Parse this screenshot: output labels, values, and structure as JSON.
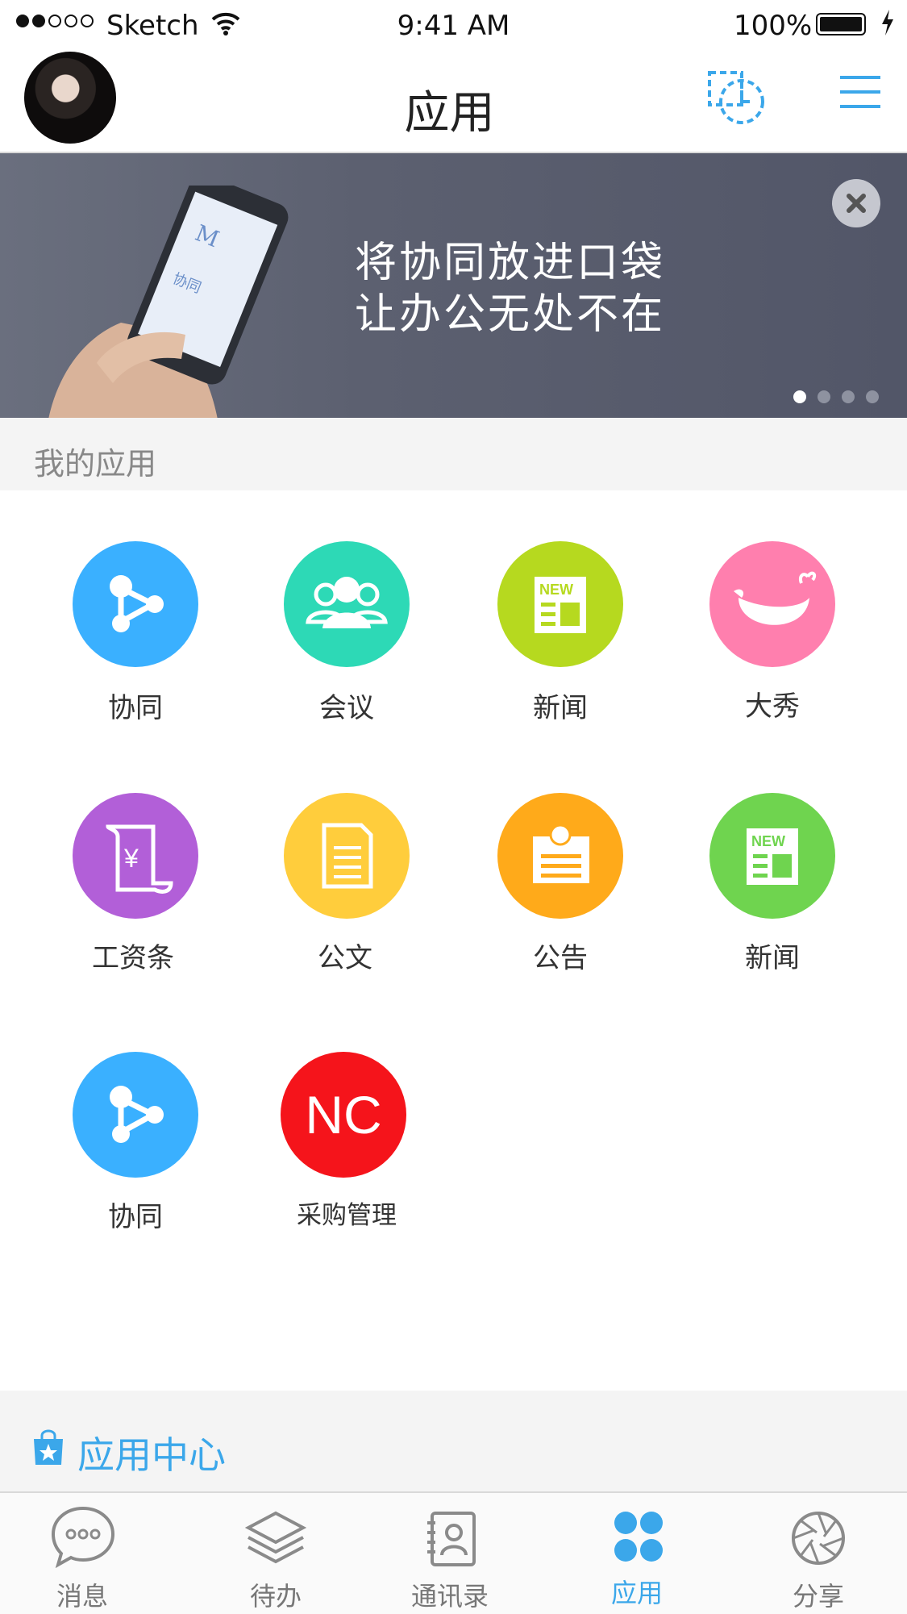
{
  "status_bar": {
    "carrier": "Sketch",
    "time": "9:41 AM",
    "battery": "100%"
  },
  "header": {
    "title": "应用"
  },
  "banner": {
    "line1": "将协同放进口袋",
    "line2": "让办公无处不在",
    "pages": 4,
    "current_page": 1
  },
  "my_apps": {
    "section_label": "我的应用",
    "apps": [
      {
        "label": "协同",
        "color": "#3ab0ff",
        "icon": "share-icon"
      },
      {
        "label": "会议",
        "color": "#2dd9b6",
        "icon": "people-icon"
      },
      {
        "label": "新闻",
        "color": "#b6d91f",
        "icon": "news-icon"
      },
      {
        "label": "大秀",
        "color": "#ff7fae",
        "icon": "whale-icon"
      },
      {
        "label": "工资条",
        "color": "#b25fd8",
        "icon": "salary-icon"
      },
      {
        "label": "公文",
        "color": "#ffcd3c",
        "icon": "document-icon"
      },
      {
        "label": "公告",
        "color": "#ffaa1a",
        "icon": "notice-icon"
      },
      {
        "label": "新闻",
        "color": "#6fd44f",
        "icon": "news-icon"
      },
      {
        "label": "协同",
        "color": "#3ab0ff",
        "icon": "share-icon"
      },
      {
        "label": "采购管理",
        "color": "#f5141b",
        "icon": "nc-logo",
        "icon_text": "NC"
      }
    ]
  },
  "app_center": {
    "label": "应用中心"
  },
  "tabbar": {
    "tabs": [
      {
        "label": "消息",
        "icon": "chat-icon",
        "active": false
      },
      {
        "label": "待办",
        "icon": "layers-icon",
        "active": false
      },
      {
        "label": "通讯录",
        "icon": "contacts-icon",
        "active": false
      },
      {
        "label": "应用",
        "icon": "apps-icon",
        "active": true
      },
      {
        "label": "分享",
        "icon": "aperture-icon",
        "active": false
      }
    ]
  },
  "colors": {
    "accent": "#3ba7ea"
  }
}
